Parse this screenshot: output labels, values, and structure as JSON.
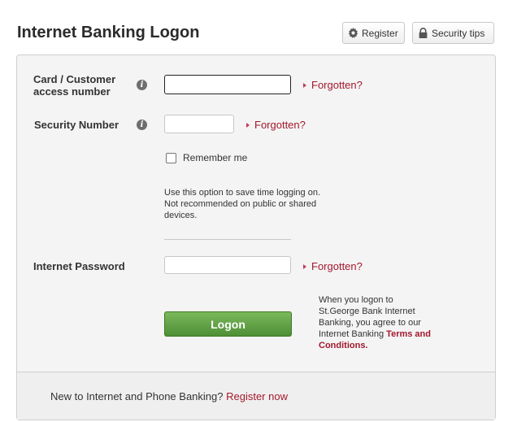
{
  "header": {
    "title": "Internet Banking Logon",
    "register_label": "Register",
    "security_tips_label": "Security tips"
  },
  "form": {
    "card_label_line1": "Card / Customer",
    "card_label_line2": "access number",
    "card_value": "",
    "security_number_label": "Security Number",
    "security_number_value": "",
    "forgotten_label": "Forgotten?",
    "remember_me_label": "Remember me",
    "remember_me_checked": false,
    "remember_help_line1": "Use this option to save time logging on.",
    "remember_help_line2": "Not recommended on public or shared",
    "remember_help_line3": "devices.",
    "password_label": "Internet Password",
    "password_value": "",
    "logon_label": "Logon",
    "terms_line1": "When you logon to",
    "terms_line2": "St.George Bank Internet",
    "terms_line3": "Banking, you agree to our",
    "terms_line4": "Internet Banking ",
    "terms_link_a": "Terms and",
    "terms_link_b": "Conditions."
  },
  "footer": {
    "text": "New to Internet and Phone Banking? ",
    "register_now_label": "Register now"
  },
  "colors": {
    "link_red": "#a3182d",
    "logon_green": "#5a9a3e",
    "panel_bg": "#f4f4f4"
  },
  "icons": {
    "register": "gear-icon",
    "security_tips": "lock-icon",
    "info": "info-icon",
    "forgot_arrow": "caret-right-icon"
  }
}
